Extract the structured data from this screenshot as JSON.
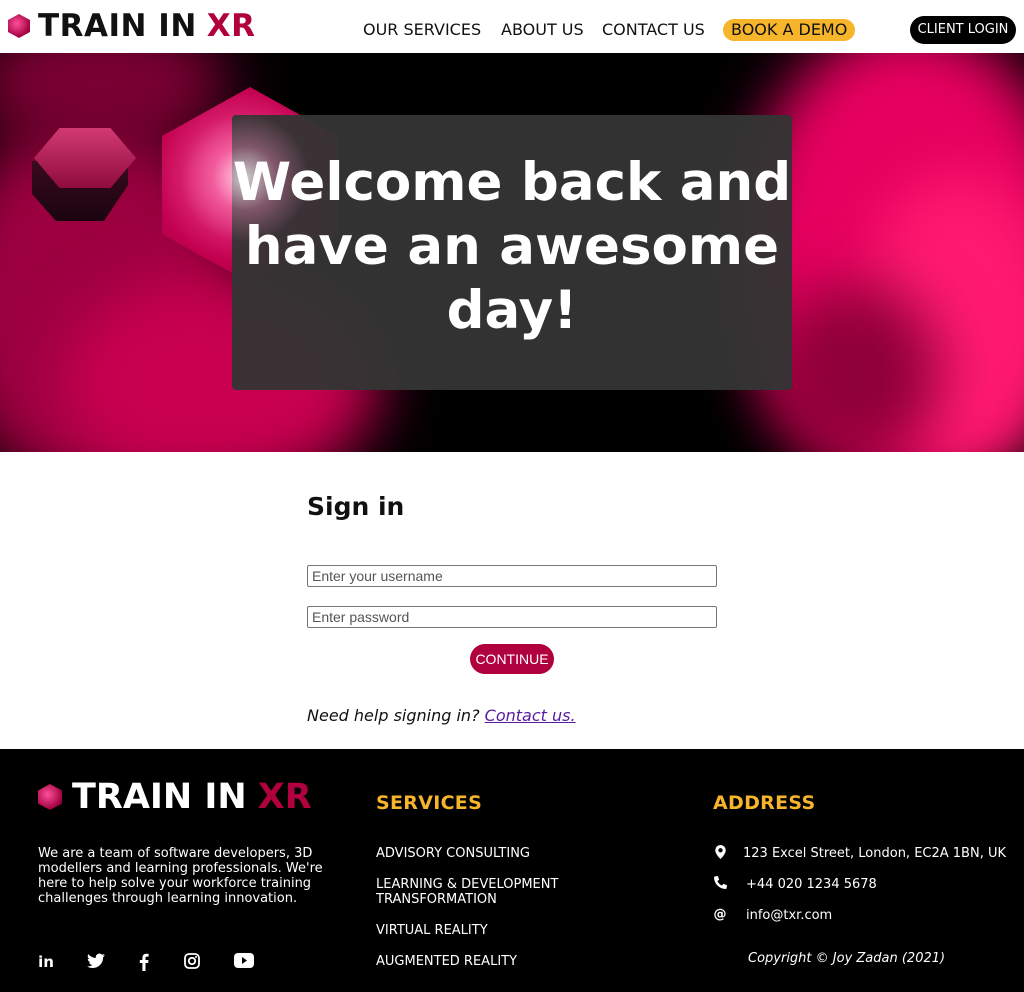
{
  "header": {
    "logo_left": "TRAIN IN",
    "logo_right": "XR",
    "nav": [
      "OUR SERVICES",
      "ABOUT US",
      "CONTACT US"
    ],
    "demo": "BOOK A DEMO",
    "login": "CLIENT LOGIN"
  },
  "hero": {
    "title": "Welcome back and have an awesome day!"
  },
  "signin": {
    "title": "Sign in",
    "username_placeholder": "Enter your username",
    "password_placeholder": "Enter password",
    "continue": "CONTINUE",
    "help_text": "Need help signing in?",
    "help_link": "Contact us."
  },
  "footer": {
    "logo_left": "TRAIN IN",
    "logo_right": "XR",
    "about": "We are a team of software developers, 3D modellers and learning professionals. We're here to help solve your workforce training challenges through learning innovation.",
    "social": [
      "in",
      "twitter",
      "facebook",
      "instagram",
      "youtube"
    ],
    "services_title": "SERVICES",
    "services": [
      "ADVISORY CONSULTING",
      "LEARNING & DEVELOPMENT TRANSFORMATION",
      "VIRTUAL REALITY",
      "AUGMENTED REALITY"
    ],
    "address_title": "ADDRESS",
    "address": "123 Excel Street, London, EC2A 1BN, UK",
    "phone": "+44 020 1234 5678",
    "email": "info@txr.com",
    "copyright": "Copyright © Joy Zadan (2021)"
  },
  "colors": {
    "brand": "#b0003e",
    "accent": "#f6b52a"
  }
}
